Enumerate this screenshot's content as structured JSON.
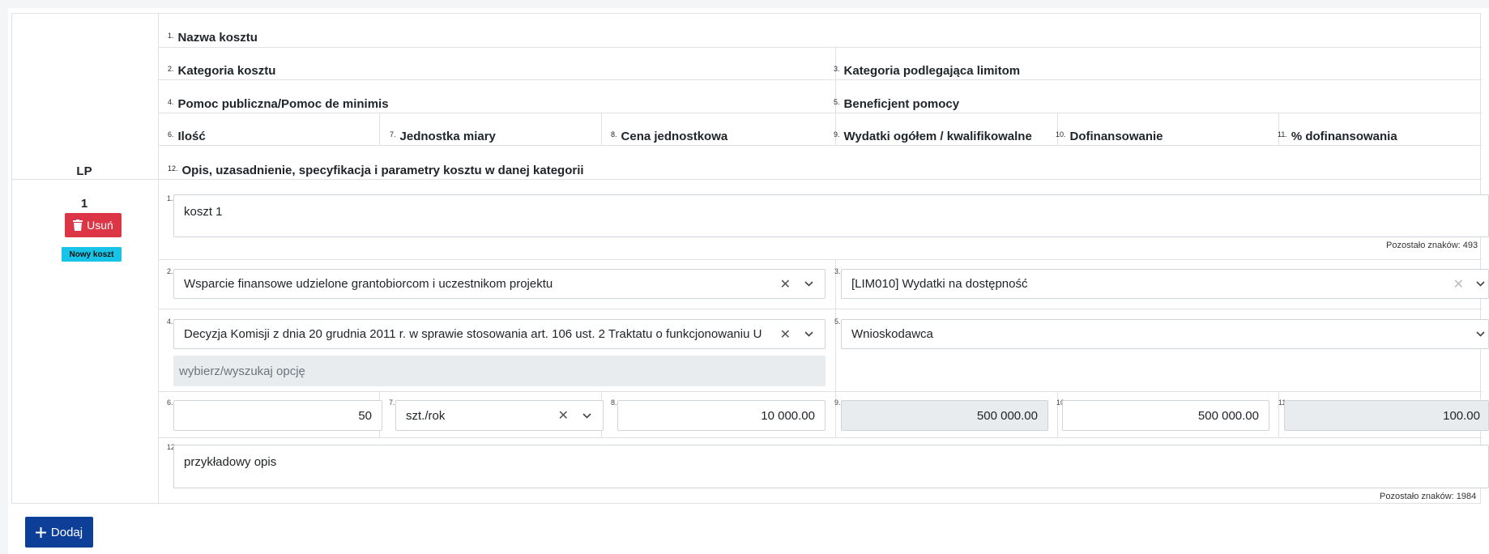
{
  "header": {
    "lp": "LP",
    "n1": "1.",
    "h1": "Nazwa kosztu",
    "n2": "2.",
    "h2": "Kategoria kosztu",
    "n3": "3.",
    "h3": "Kategoria podlegająca limitom",
    "n4": "4.",
    "h4": "Pomoc publiczna/Pomoc de minimis",
    "n5": "5.",
    "h5": "Beneficjent pomocy",
    "n6": "6.",
    "h6": "Ilość",
    "n7": "7.",
    "h7": "Jednostka miary",
    "n8": "8.",
    "h8": "Cena jednostkowa",
    "n9": "9.",
    "h9": "Wydatki ogółem / kwalifikowalne",
    "n10": "10.",
    "h10": "Dofinansowanie",
    "n11": "11.",
    "h11": "% dofinansowania",
    "n12": "12.",
    "h12": "Opis, uzasadnienie, specyfikacja i parametry kosztu w danej kategorii"
  },
  "row": {
    "lp": "1",
    "delete_label": "Usuń",
    "badge": "Nowy koszt",
    "idx1": "1.",
    "idx2": "2.",
    "idx3": "3.",
    "idx4": "4.",
    "idx5": "5.",
    "idx6": "6.",
    "idx7": "7.",
    "idx8": "8.",
    "idx9": "9.",
    "idx10": "10.",
    "idx11": "11.",
    "idx12": "12.",
    "name": "koszt 1",
    "name_counter": "Pozostało znaków: 493",
    "category": "Wsparcie finansowe udzielone grantobiorcom i uczestnikom projektu",
    "limit_category": "[LIM010] Wydatki na dostępność",
    "aid": "Decyzja Komisji z dnia 20 grudnia 2011 r. w sprawie stosowania art. 106 ust. 2 Traktatu o funkcjonowaniu U",
    "aid_search_placeholder": "wybierz/wyszukaj opcję",
    "beneficiary": "Wnioskodawca",
    "quantity": "50",
    "unit": "szt./rok",
    "unit_price": "10 000.00",
    "total": "500 000.00",
    "funding": "500 000.00",
    "funding_pct": "100.00",
    "description": "przykładowy opis",
    "description_counter": "Pozostało znaków: 1984"
  },
  "actions": {
    "add_label": "Dodaj"
  },
  "colors": {
    "danger": "#dc3545",
    "info": "#17c3e6",
    "primary": "#0d3f99",
    "readonly": "#e9ecef"
  }
}
